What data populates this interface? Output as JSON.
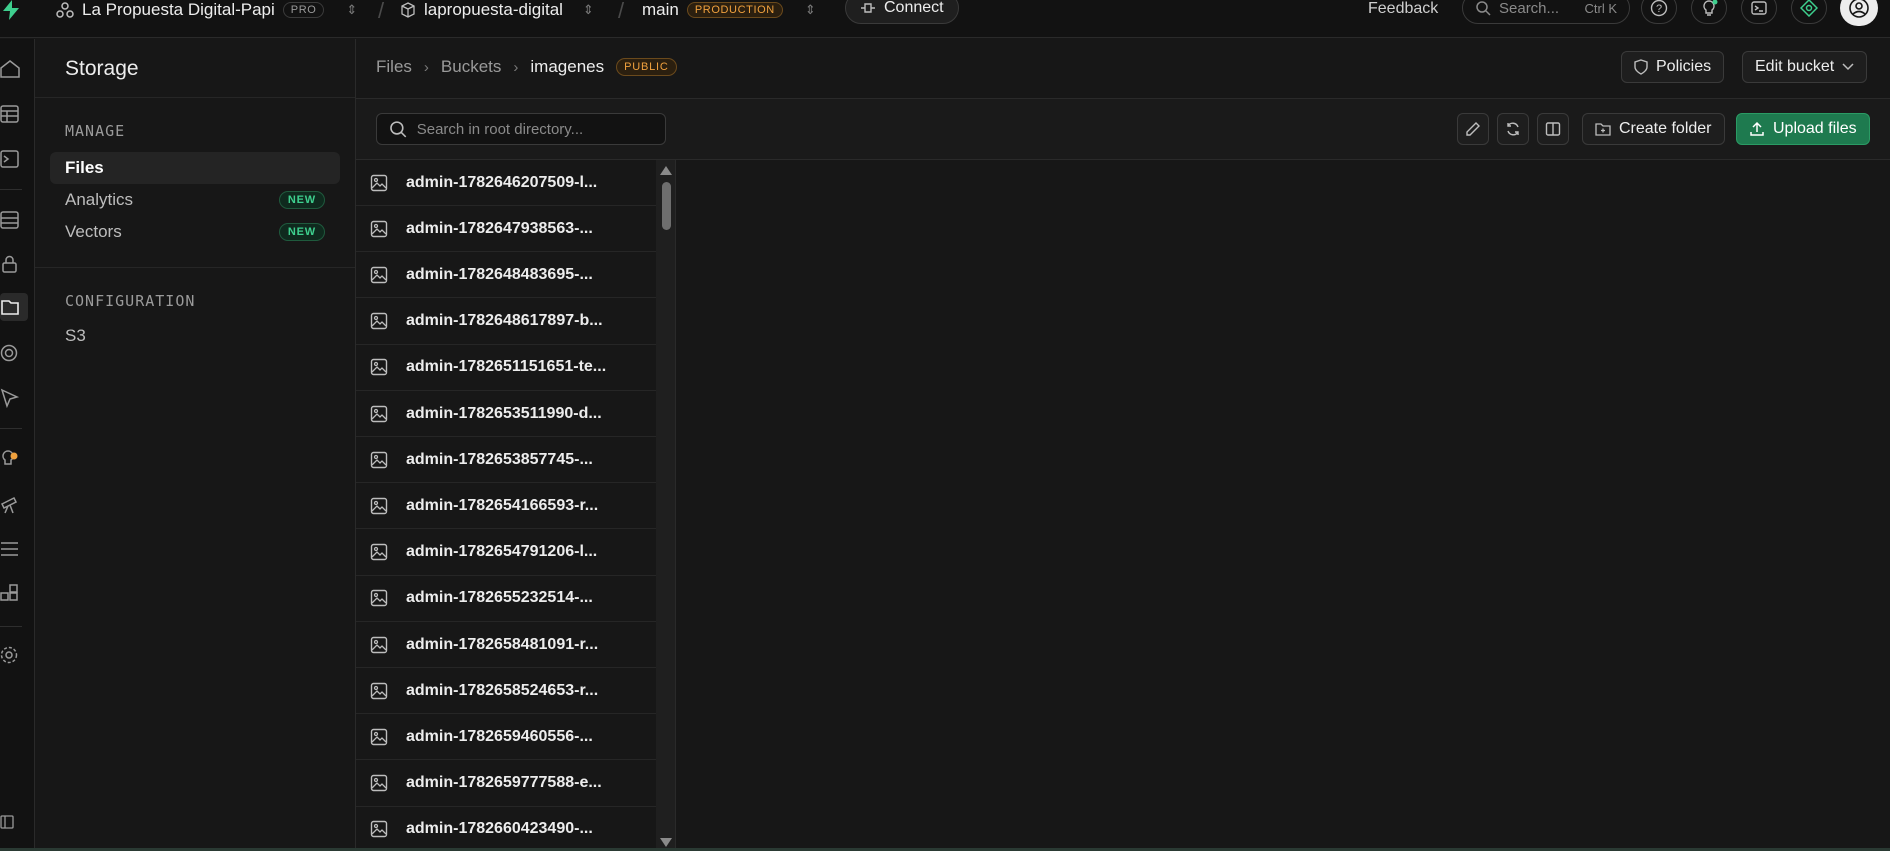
{
  "topbar": {
    "org_name": "La Propuesta Digital-Papi",
    "org_plan": "PRO",
    "project_name": "lapropuesta-digital",
    "branch_name": "main",
    "branch_env": "PRODUCTION",
    "connect_label": "Connect",
    "feedback_label": "Feedback",
    "search_placeholder": "Search...",
    "search_shortcut": "Ctrl K"
  },
  "menu": {
    "title": "Storage",
    "section_manage": "MANAGE",
    "items": [
      {
        "label": "Files",
        "badge": ""
      },
      {
        "label": "Analytics",
        "badge": "NEW"
      },
      {
        "label": "Vectors",
        "badge": "NEW"
      }
    ],
    "section_config": "CONFIGURATION",
    "config_items": [
      {
        "label": "S3"
      }
    ]
  },
  "breadcrumb": {
    "files": "Files",
    "buckets": "Buckets",
    "bucket": "imagenes",
    "bucket_badge": "PUBLIC"
  },
  "actions": {
    "policies": "Policies",
    "edit_bucket": "Edit bucket",
    "create_folder": "Create folder",
    "upload_files": "Upload files"
  },
  "file_search": {
    "placeholder": "Search in root directory..."
  },
  "files": [
    "admin-1782646207509-l...",
    "admin-1782647938563-...",
    "admin-1782648483695-...",
    "admin-1782648617897-b...",
    "admin-1782651151651-te...",
    "admin-1782653511990-d...",
    "admin-1782653857745-...",
    "admin-1782654166593-r...",
    "admin-1782654791206-l...",
    "admin-1782655232514-...",
    "admin-1782658481091-r...",
    "admin-1782658524653-r...",
    "admin-1782659460556-...",
    "admin-1782659777588-e...",
    "admin-1782660423490-..."
  ],
  "colors": {
    "accent": "#3ecf8e",
    "upload": "#1e7a4f",
    "warning": "#f0a13e"
  }
}
